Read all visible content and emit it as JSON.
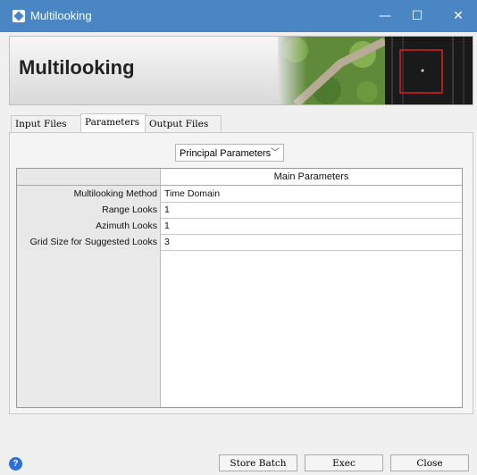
{
  "window": {
    "title": "Multilooking",
    "minimize_glyph": "—",
    "maximize_glyph": "☐",
    "close_glyph": "✕"
  },
  "banner": {
    "title": "Multilooking"
  },
  "tabs": [
    {
      "label": "Input Files",
      "active": false
    },
    {
      "label": "Parameters",
      "active": true
    },
    {
      "label": "Output Files",
      "active": false
    }
  ],
  "parameter_group_select": {
    "selected": "Principal Parameters"
  },
  "table": {
    "header": "Main Parameters",
    "rows": [
      {
        "label": "Multilooking Method",
        "value": "Time Domain"
      },
      {
        "label": "Range Looks",
        "value": "1"
      },
      {
        "label": "Azimuth Looks",
        "value": "1"
      },
      {
        "label": "Grid Size for Suggested Looks",
        "value": "3"
      }
    ]
  },
  "footer": {
    "help_glyph": "?",
    "store_batch_label": "Store Batch",
    "exec_label": "Exec",
    "close_label": "Close"
  },
  "colors": {
    "titlebar": "#4a86c4",
    "help_icon": "#2d6fd6"
  }
}
